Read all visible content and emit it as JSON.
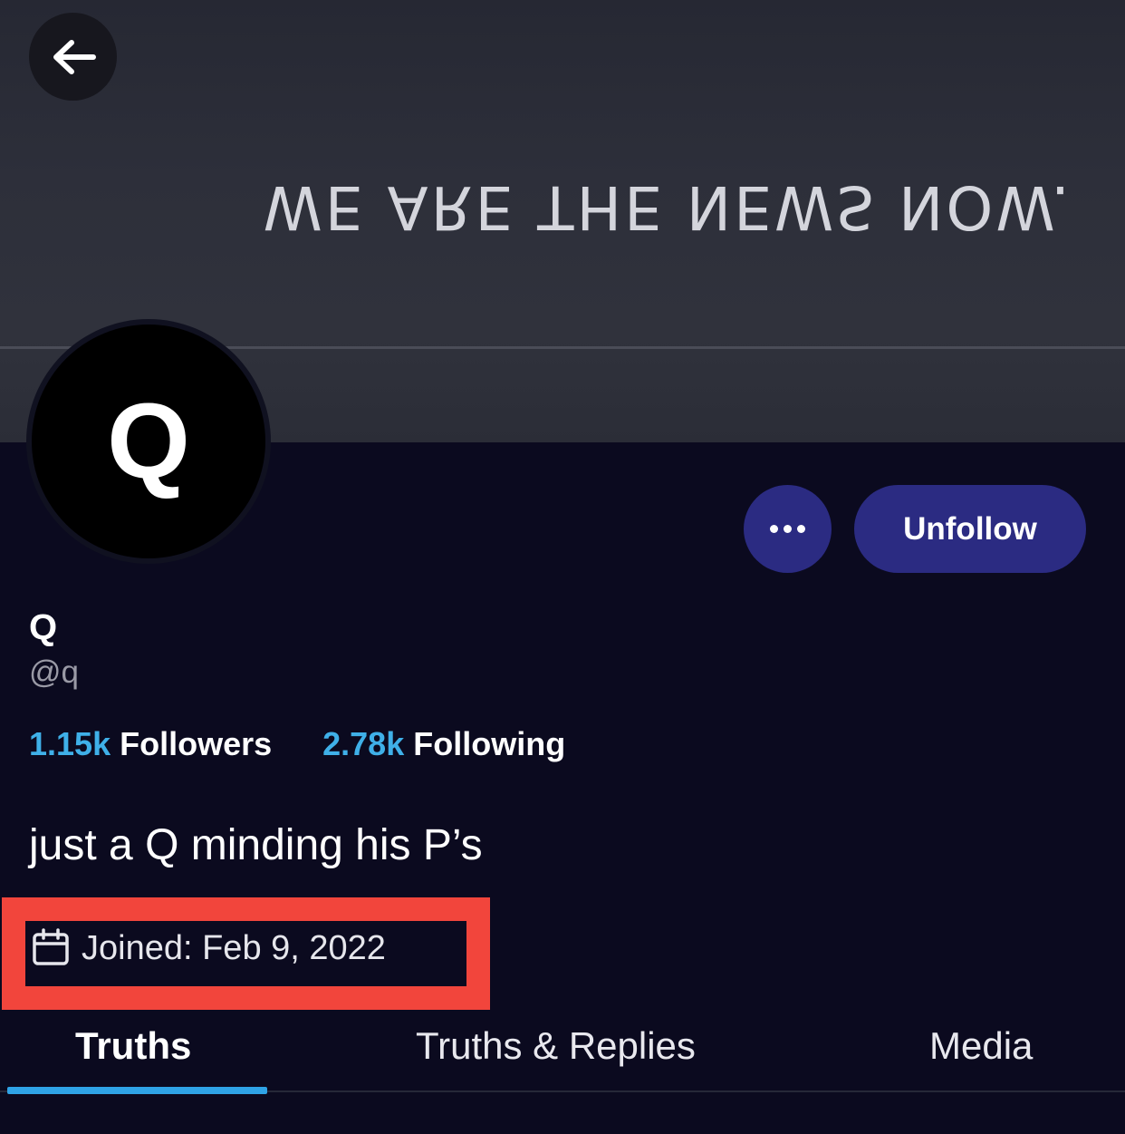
{
  "banner": {
    "text": "WE ARE THE NEWS NOW."
  },
  "header": {
    "back_icon": "arrow-left-icon"
  },
  "profile": {
    "avatar_letter": "Q",
    "display_name": "Q",
    "handle": "@q",
    "bio": "just a Q minding his P’s",
    "joined": "Joined: Feb 9, 2022",
    "joined_icon": "calendar-icon"
  },
  "actions": {
    "more_icon": "ellipsis-icon",
    "unfollow_label": "Unfollow"
  },
  "stats": {
    "followers_count": "1.15k",
    "followers_label": "Followers",
    "following_count": "2.78k",
    "following_label": "Following"
  },
  "tabs": [
    {
      "label": "Truths",
      "active": true
    },
    {
      "label": "Truths & Replies",
      "active": false
    },
    {
      "label": "Media",
      "active": false
    }
  ],
  "colors": {
    "accent_blue": "#3fb0e8",
    "button_indigo": "#2b2b82",
    "background": "#0b0a1f",
    "highlight_red": "#f2453c"
  }
}
